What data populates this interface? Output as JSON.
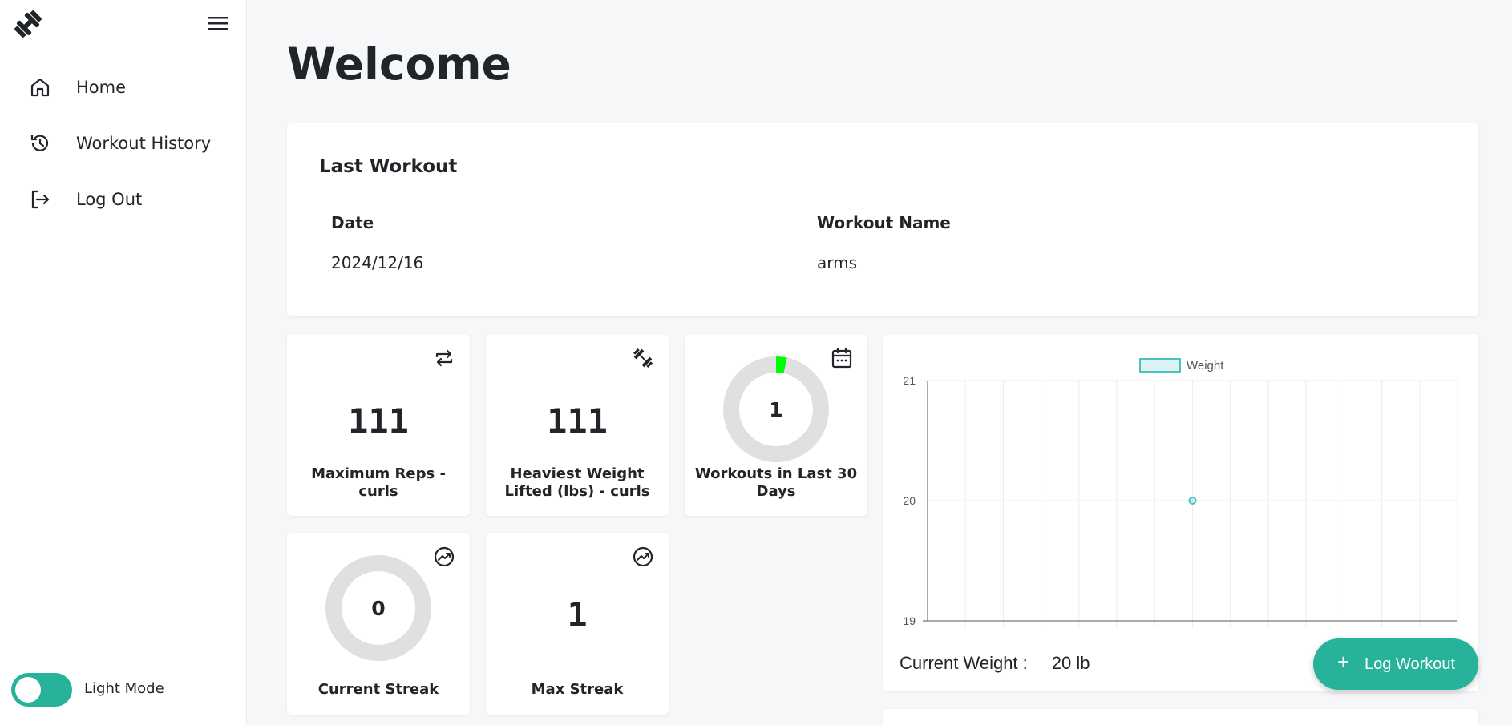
{
  "sidebar": {
    "items": [
      {
        "label": "Home",
        "icon": "home-icon"
      },
      {
        "label": "Workout History",
        "icon": "history-icon"
      },
      {
        "label": "Log Out",
        "icon": "logout-icon"
      }
    ],
    "theme_toggle_label": "Light Mode",
    "theme_toggle_on": true
  },
  "main": {
    "title": "Welcome",
    "last_workout": {
      "heading": "Last Workout",
      "columns": [
        "Date",
        "Workout Name"
      ],
      "rows": [
        [
          "2024/12/16",
          "arms"
        ]
      ]
    },
    "stats": [
      {
        "value": "111",
        "label": "Maximum Reps - curls",
        "icon": "repeat-icon"
      },
      {
        "value": "111",
        "label": "Heaviest Weight Lifted (lbs) - curls",
        "icon": "dumbbell-icon"
      },
      {
        "value": "1",
        "label": "Workouts in Last 30 Days",
        "icon": "calendar-icon",
        "progress": 0.033
      },
      {
        "value": "0",
        "label": "Current Streak",
        "icon": "trending-up-icon",
        "progress": 0
      },
      {
        "value": "1",
        "label": "Max Streak",
        "icon": "trending-up-icon"
      }
    ],
    "current_weight": {
      "label": "Current Weight :",
      "value": "20 lb"
    },
    "log_workout_label": "Log Workout"
  },
  "colors": {
    "accent": "#26b39a",
    "chart_line": "#4bc0c0",
    "ring_progress": "#00ff00",
    "ring_track": "#e0e0e0"
  },
  "chart_data": {
    "type": "line",
    "series": [
      {
        "name": "Weight",
        "values": [
          {
            "x": 7,
            "y": 20
          }
        ]
      }
    ],
    "y_ticks": [
      "21",
      "20",
      "19"
    ],
    "ylim": [
      19,
      21
    ],
    "x_count": 15,
    "legend": "top-center",
    "grid": true
  }
}
